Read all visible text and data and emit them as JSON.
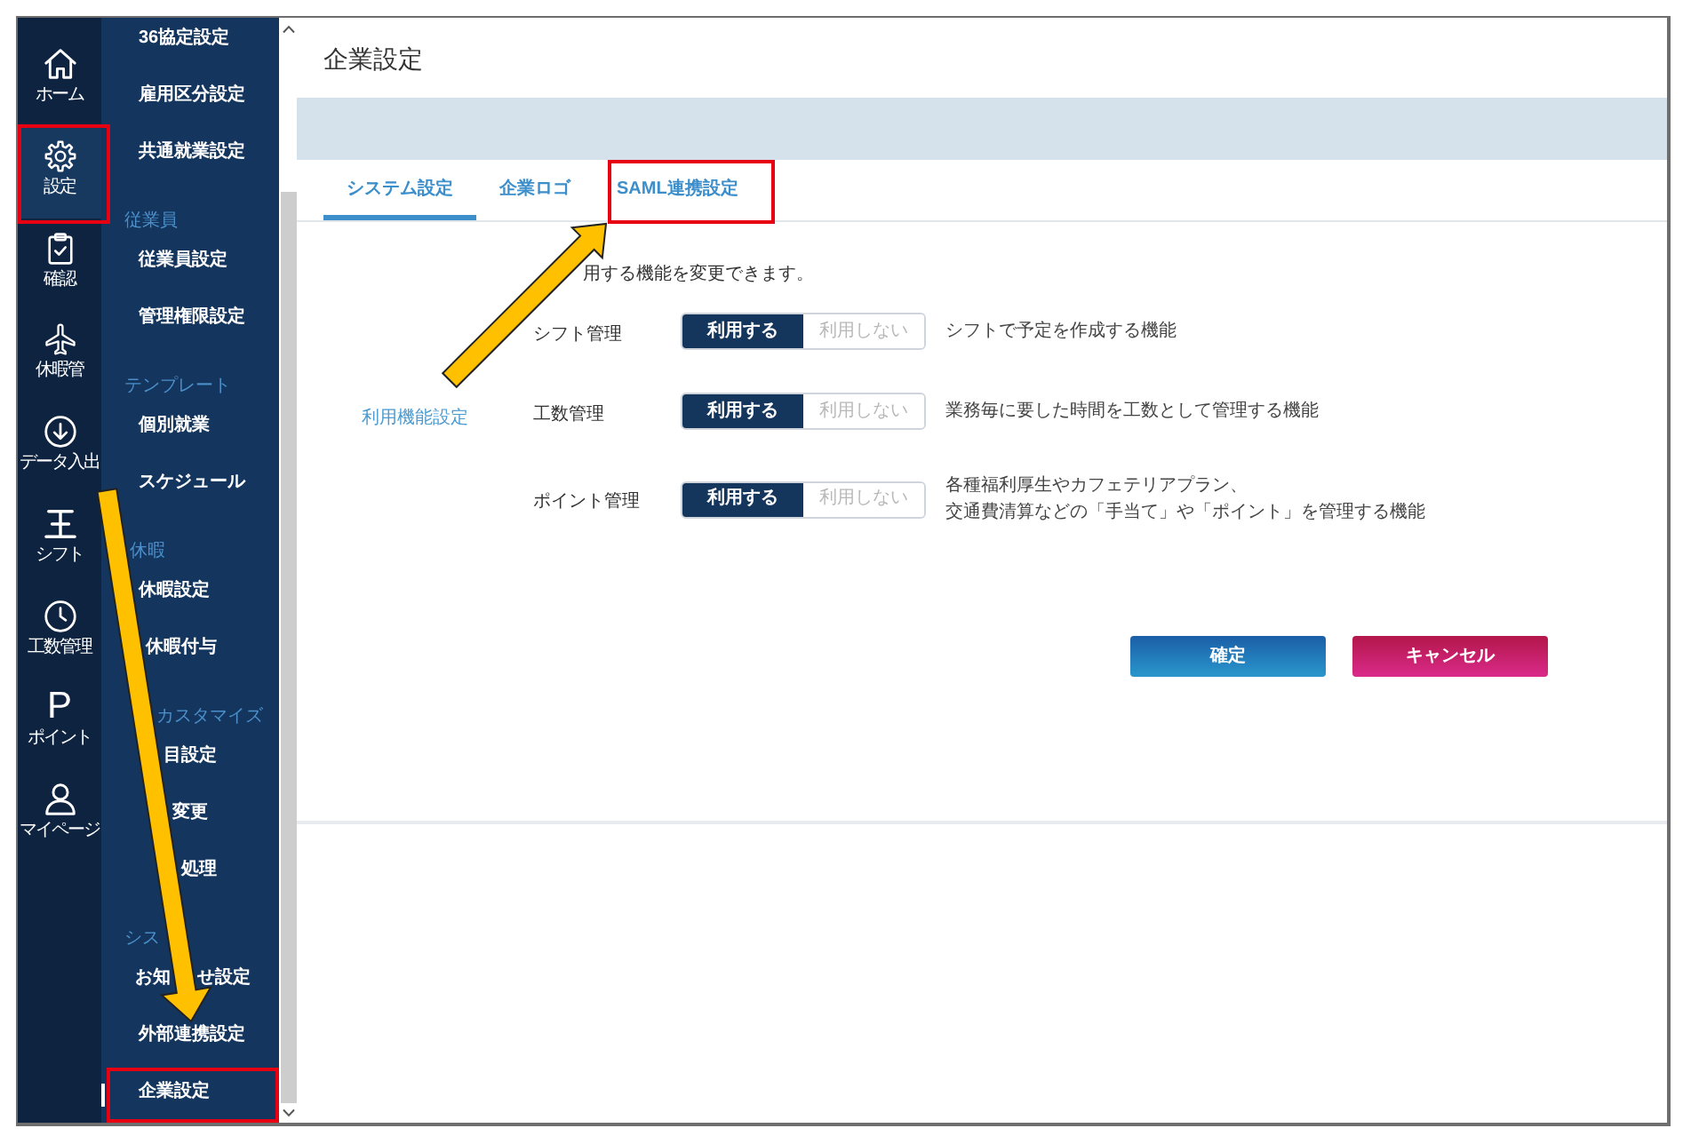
{
  "rail": {
    "items": [
      {
        "label": "ホーム",
        "selected": false
      },
      {
        "label": "設定",
        "selected": true
      },
      {
        "label": "確認",
        "selected": false
      },
      {
        "label": "休暇管",
        "selected": false
      },
      {
        "label": "データ入出",
        "selected": false
      },
      {
        "label": "シフト",
        "selected": false
      },
      {
        "label": "工数管理",
        "selected": false
      },
      {
        "glyph": "P",
        "label": "ポイント",
        "selected": false
      },
      {
        "label": "マイページ",
        "selected": false
      }
    ]
  },
  "sidebar": {
    "sections": [
      {
        "items": [
          {
            "label": "36協定設定",
            "selected": false
          },
          {
            "label": "雇用区分設定",
            "selected": false
          },
          {
            "label": "共通就業設定",
            "selected": false
          }
        ]
      },
      {
        "heading": "従業員",
        "items": [
          {
            "label": "従業員設定",
            "selected": false
          },
          {
            "label": "管理権限設定",
            "selected": false
          }
        ]
      },
      {
        "heading": "テンプレート",
        "items": [
          {
            "label": "個別就業",
            "selected": false
          },
          {
            "label": "スケジュール",
            "selected": false
          }
        ]
      },
      {
        "heading": "休暇",
        "items": [
          {
            "label": "休暇設定",
            "selected": false
          },
          {
            "label": "休暇付与",
            "selected": false
          }
        ]
      },
      {
        "heading": "カスタマイズ",
        "items": [
          {
            "label": "目設定",
            "selected": false
          },
          {
            "label": "変更",
            "selected": false
          },
          {
            "label": "処理",
            "selected": false
          }
        ]
      },
      {
        "heading": "シス",
        "items": [
          {
            "label": "お知 せ設定",
            "selected": false
          },
          {
            "label": "外部連携設定",
            "selected": false
          },
          {
            "label": "企業設定",
            "selected": true
          }
        ]
      }
    ]
  },
  "page": {
    "title": "企業設定",
    "tabs": [
      {
        "label": "システム設定",
        "selected": true
      },
      {
        "label": "企業ロゴ",
        "selected": false
      },
      {
        "label": "SAML連携設定",
        "selected": false
      }
    ]
  },
  "settings": {
    "label": "利用機能設定",
    "intro": "用する機能を変更できます。",
    "features": [
      {
        "name": "シフト管理",
        "options": [
          {
            "label": "利用する",
            "selected": true
          },
          {
            "label": "利用しない",
            "selected": false
          }
        ],
        "description": [
          "シフトで予定を作成する機能"
        ]
      },
      {
        "name": "工数管理",
        "options": [
          {
            "label": "利用する",
            "selected": true
          },
          {
            "label": "利用しない",
            "selected": false
          }
        ],
        "description": [
          "業務毎に要した時間を工数として管理する機能"
        ]
      },
      {
        "name": "ポイント管理",
        "options": [
          {
            "label": "利用する",
            "selected": true
          },
          {
            "label": "利用しない",
            "selected": false
          }
        ],
        "description": [
          "各種福利厚生やカフェテリアプラン、",
          "交通費清算などの「手当て」や「ポイント」を管理する機能"
        ]
      }
    ]
  },
  "buttons": [
    {
      "label": "確定",
      "kind": "confirm"
    },
    {
      "label": "キャンセル",
      "kind": "cancel"
    }
  ]
}
